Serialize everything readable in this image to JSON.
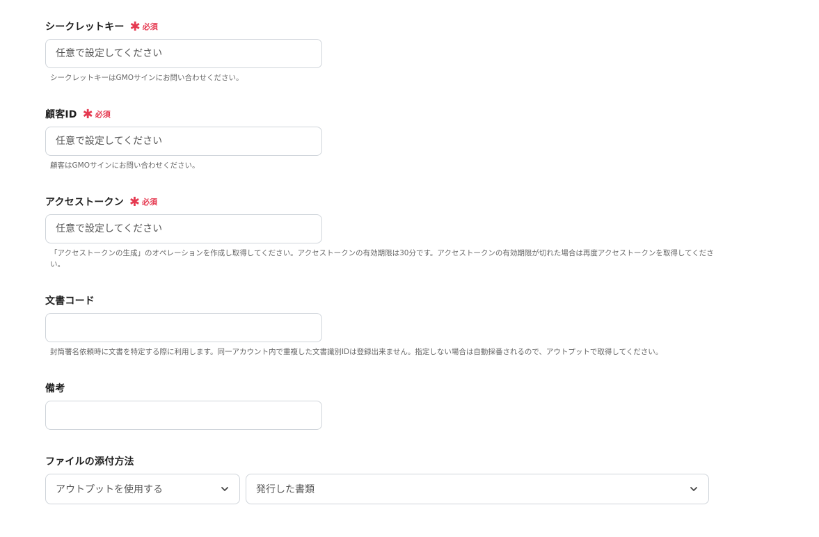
{
  "fields": {
    "secret_key": {
      "label": "シークレットキー",
      "required_text": "必須",
      "placeholder": "任意で設定してください",
      "value": "",
      "help": "シークレットキーはGMOサインにお問い合わせください。"
    },
    "customer_id": {
      "label": "顧客ID",
      "required_text": "必須",
      "placeholder": "任意で設定してください",
      "value": "",
      "help": "顧客はGMOサインにお問い合わせください。"
    },
    "access_token": {
      "label": "アクセストークン",
      "required_text": "必須",
      "placeholder": "任意で設定してください",
      "value": "",
      "help": "「アクセストークンの生成」のオペレーションを作成し取得してください。アクセストークンの有効期限は30分です。アクセストークンの有効期限が切れた場合は再度アクセストークンを取得してください。"
    },
    "document_code": {
      "label": "文書コード",
      "placeholder": "",
      "value": "",
      "help": "封筒署名依頼時に文書を特定する際に利用します。同一アカウント内で重複した文書識別IDは登録出来ません。指定しない場合は自動採番されるので、アウトプットで取得してください。"
    },
    "remarks": {
      "label": "備考",
      "placeholder": "",
      "value": ""
    },
    "attachment_method": {
      "label": "ファイルの添付方法",
      "source_select": {
        "selected": "アウトプットを使用する"
      },
      "output_select": {
        "selected": "発行した書類"
      }
    }
  },
  "icons": {
    "required": "asterisk-icon",
    "dropdown": "chevron-down-icon"
  },
  "colors": {
    "required": "#e53950",
    "border": "#cfd4da",
    "help_text": "#666666"
  }
}
